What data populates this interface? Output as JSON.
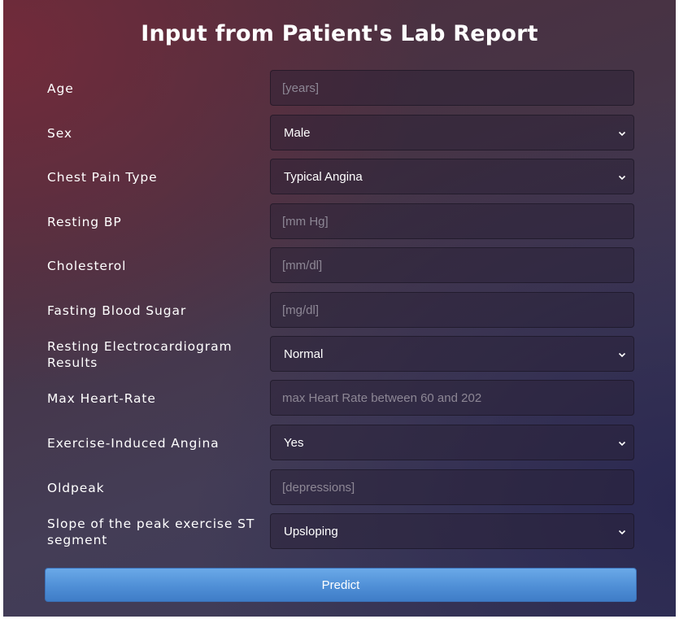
{
  "title": "Input from Patient's Lab Report",
  "fields": {
    "age": {
      "label": "Age",
      "placeholder": "[years]",
      "value": ""
    },
    "sex": {
      "label": "Sex",
      "selected": "Male"
    },
    "chest_pain": {
      "label": "Chest Pain Type",
      "selected": "Typical Angina"
    },
    "resting_bp": {
      "label": "Resting BP",
      "placeholder": "[mm Hg]",
      "value": ""
    },
    "cholesterol": {
      "label": "Cholesterol",
      "placeholder": "[mm/dl]",
      "value": ""
    },
    "fasting_sugar": {
      "label": "Fasting Blood Sugar",
      "placeholder": "[mg/dl]",
      "value": ""
    },
    "resting_ecg": {
      "label": "Resting Electrocardiogram Results",
      "selected": "Normal"
    },
    "max_hr": {
      "label": "Max Heart-Rate",
      "placeholder": "max Heart Rate between 60 and 202",
      "value": ""
    },
    "exercise_angina": {
      "label": "Exercise-Induced Angina",
      "selected": "Yes"
    },
    "oldpeak": {
      "label": "Oldpeak",
      "placeholder": "[depressions]",
      "value": ""
    },
    "st_slope": {
      "label": "Slope of the peak exercise ST segment",
      "selected": "Upsloping"
    }
  },
  "icons": {
    "dropdown": "chevron-down-icon"
  },
  "predict_label": "Predict",
  "colors": {
    "button": "#4f8fd6",
    "text": "#ffffff",
    "placeholder": "#8d8795"
  }
}
